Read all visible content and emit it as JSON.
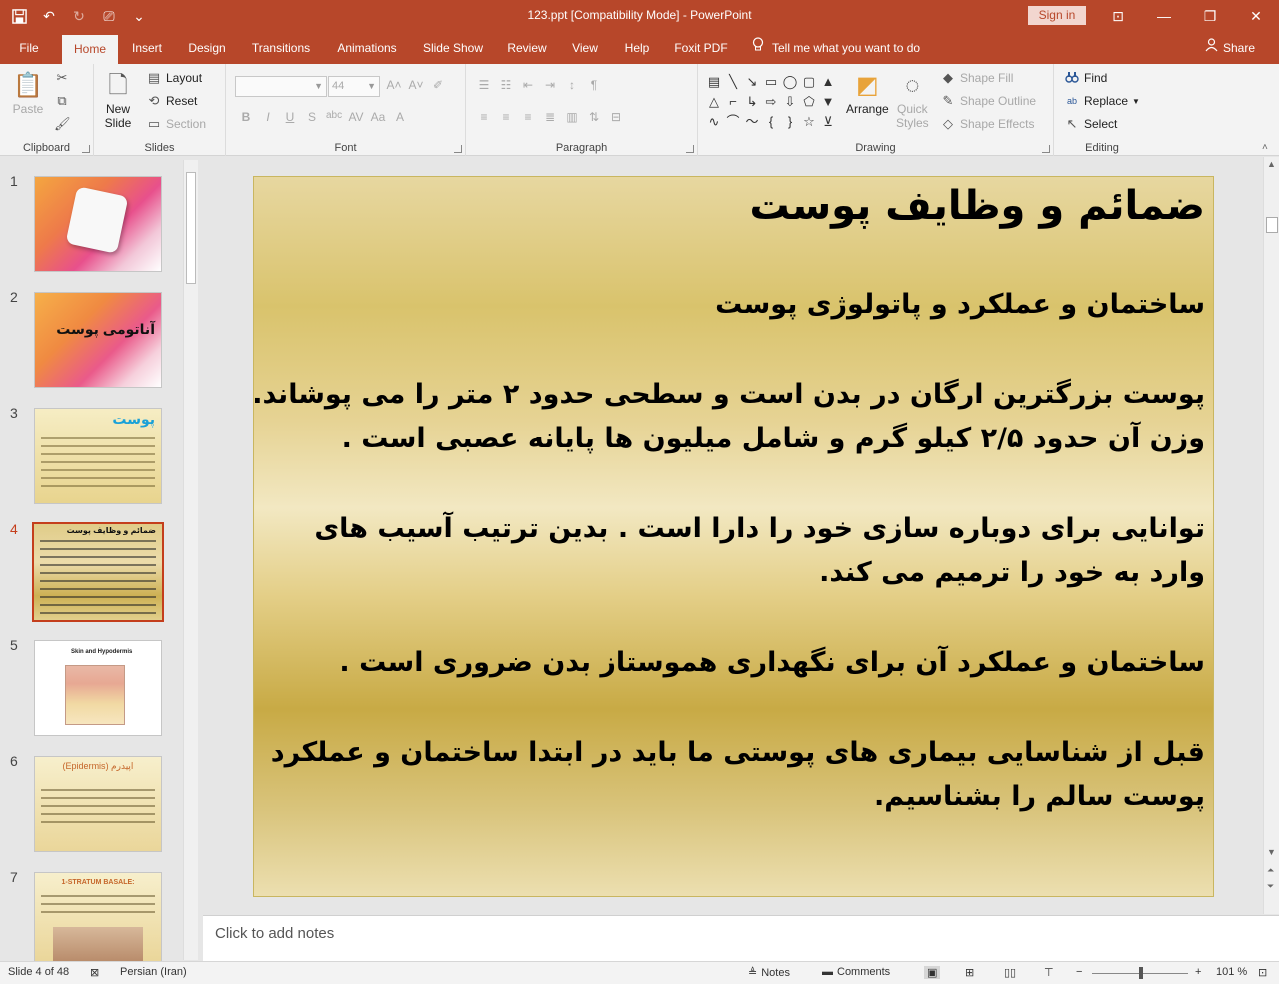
{
  "window": {
    "title": "123.ppt [Compatibility Mode]  -  PowerPoint",
    "sign_in": "Sign in"
  },
  "ribbon_tabs": [
    "File",
    "Home",
    "Insert",
    "Design",
    "Transitions",
    "Animations",
    "Slide Show",
    "Review",
    "View",
    "Help",
    "Foxit PDF"
  ],
  "tell_me": "Tell me what you want to do",
  "share": "Share",
  "ribbon": {
    "clipboard": {
      "label": "Clipboard",
      "paste": "Paste"
    },
    "slides": {
      "label": "Slides",
      "new_slide_1": "New",
      "new_slide_2": "Slide",
      "layout": "Layout",
      "reset": "Reset",
      "section": "Section"
    },
    "font": {
      "label": "Font",
      "size": "44"
    },
    "paragraph": {
      "label": "Paragraph"
    },
    "drawing": {
      "label": "Drawing",
      "arrange": "Arrange",
      "quick_styles_1": "Quick",
      "quick_styles_2": "Styles",
      "shape_fill": "Shape Fill",
      "shape_outline": "Shape Outline",
      "shape_effects": "Shape Effects"
    },
    "editing": {
      "label": "Editing",
      "find": "Find",
      "replace": "Replace",
      "select": "Select"
    }
  },
  "thumbnails": [
    {
      "num": "1",
      "title": ""
    },
    {
      "num": "2",
      "title": "آناتومی پوست"
    },
    {
      "num": "3",
      "title": "پوست"
    },
    {
      "num": "4",
      "title": "ضمائم و وظایف پوست"
    },
    {
      "num": "5",
      "title": "Skin and Hypodermis"
    },
    {
      "num": "6",
      "title": "اپیدرم (Epidermis)"
    },
    {
      "num": "7",
      "title": "1-STRATUM BASALE:"
    }
  ],
  "slide": {
    "title": "ضمائم و وظایف پوست",
    "lines": [
      "ساختمان و عملکرد و پاتولوژی پوست",
      "پوست بزرگترین ارگان در بدن است و سطحی حدود ۲ متر را می پوشاند.",
      "وزن آن حدود ۲/۵ کیلو گرم و شامل میلیون ها پایانه عصبی است .",
      "توانایی برای دوباره سازی خود را دارا است . بدین ترتیب آسیب های",
      "وارد به خود را ترمیم می کند.",
      "ساختمان و عملکرد آن برای نگهداری هموستاز بدن ضروری است .",
      "قبل از شناسایی بیماری های پوستی ما باید در ابتدا ساختمان و عملکرد",
      "پوست سالم را بشناسیم."
    ]
  },
  "notes_placeholder": "Click to add notes",
  "status": {
    "slide_of": "Slide 4 of 48",
    "language": "Persian (Iran)",
    "notes": "Notes",
    "comments": "Comments",
    "zoom": "101 %"
  },
  "colors": {
    "accent": "#b7472a",
    "selected_thumb": "#c43e1c"
  },
  "icons": [
    "save-icon",
    "undo-icon",
    "redo-icon",
    "present-icon",
    "customize-icon",
    "lightbulb-icon",
    "person-icon",
    "binoculars-icon",
    "replace-icon",
    "cursor-icon"
  ]
}
